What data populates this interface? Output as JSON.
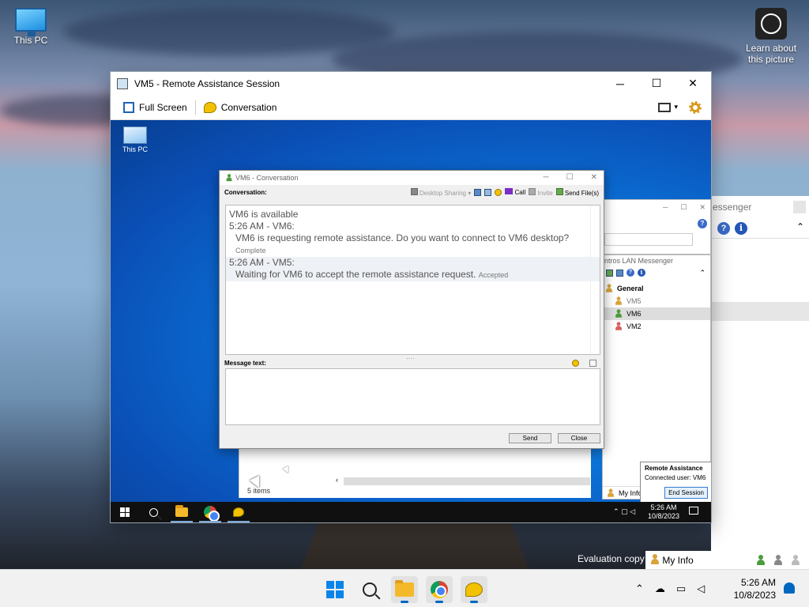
{
  "desktop": {
    "this_pc_label": "This PC",
    "learn_label": "Learn about this picture",
    "evaluation_text": "Evaluation copy",
    "host_messenger_title": "essenger",
    "host_myinfo": "My Info"
  },
  "ra_window": {
    "title": "VM5 - Remote Assistance Session",
    "min": "─",
    "max": "☐",
    "close": "✕",
    "toolbar": {
      "full_screen": "Full Screen",
      "conversation": "Conversation"
    }
  },
  "remote": {
    "this_pc_label": "This PC",
    "explorer_items": "5 items",
    "messenger": {
      "title": "ntros LAN Messenger",
      "group": "General",
      "users": [
        {
          "name": "VM5",
          "color": "#d8a33a"
        },
        {
          "name": "VM6",
          "color": "#4b9b3b"
        },
        {
          "name": "VM2",
          "color": "#d86060"
        }
      ],
      "my_info": "My Info"
    },
    "ra_panel": {
      "heading": "Remote Assistance",
      "connected": "Connected user: VM6",
      "end_session": "End Session"
    },
    "taskbar": {
      "time": "5:26 AM",
      "date": "10/8/2023"
    }
  },
  "conversation": {
    "title": "VM6 - Conversation",
    "label": "Conversation:",
    "tools": {
      "desktop_sharing": "Desktop Sharing",
      "call": "Call",
      "invite": "Invite",
      "send_files": "Send File(s)"
    },
    "log": {
      "line1": "VM6 is available",
      "line2": "5:26 AM - VM6:",
      "line3": "VM6 is requesting remote assistance. Do you want to connect to VM6 desktop?",
      "line3_status": "Complete",
      "line4": "5:26 AM - VM5:",
      "line5": "Waiting for VM6 to accept the remote assistance request.",
      "line5_status": "Accepted"
    },
    "message_label": "Message text:",
    "send": "Send",
    "close": "Close"
  },
  "taskbar": {
    "time": "5:26 AM",
    "date": "10/8/2023"
  }
}
